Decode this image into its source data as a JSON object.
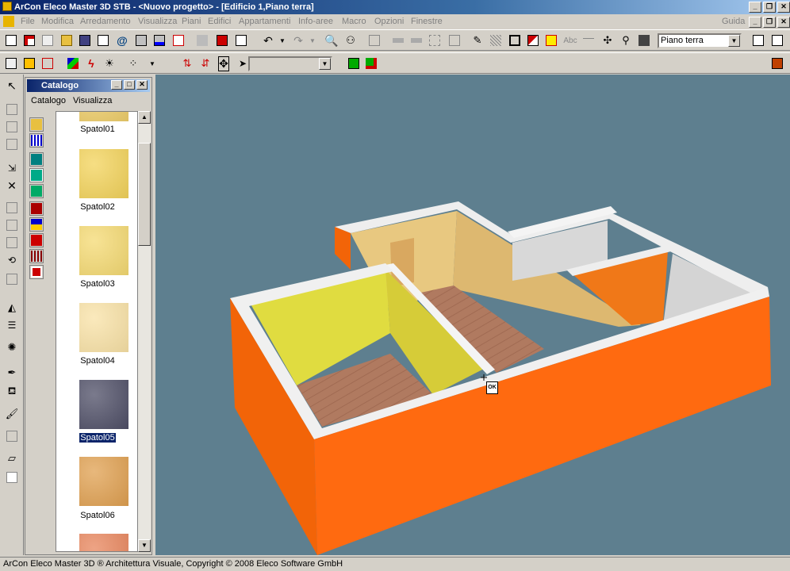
{
  "window": {
    "title": "ArCon Eleco  Master 3D STB - <Nuovo progetto> - [Edificio 1,Piano terra]"
  },
  "menu": {
    "items": [
      "File",
      "Modifica",
      "Arredamento",
      "Visualizza",
      "Piani",
      "Edifici",
      "Appartamenti",
      "Info-aree",
      "Macro",
      "Opzioni",
      "Finestre"
    ],
    "help": "Guida"
  },
  "toolbar": {
    "floor_select": "Piano terra"
  },
  "catalog": {
    "title": "Catalogo",
    "menu": [
      "Catalogo",
      "Visualizza"
    ],
    "items": [
      {
        "label": "Spatol01",
        "color": "#efce6a"
      },
      {
        "label": "Spatol02",
        "color": "#f3d35a"
      },
      {
        "label": "Spatol03",
        "color": "#f5da72"
      },
      {
        "label": "Spatol04",
        "color": "#f9e2a6"
      },
      {
        "label": "Spatol05",
        "color": "#4e4e66",
        "selected": true
      },
      {
        "label": "Spatol06",
        "color": "#e0a050"
      },
      {
        "label": "",
        "color": "#e8855c"
      }
    ]
  },
  "viewport": {
    "snap_label": "OK"
  },
  "status": {
    "text": "ArCon Eleco  Master 3D ® Architettura Visuale, Copyright © 2008 Eleco Software GmbH"
  },
  "colors": {
    "viewport_bg": "#5e7f8f",
    "outer_wall": "#ff6a10",
    "wall_top": "#ffffff",
    "floor": "#b07a60",
    "room_yellow": "#e0dc40",
    "room_beige": "#e8c880",
    "room_grey": "#d8d8d8"
  }
}
